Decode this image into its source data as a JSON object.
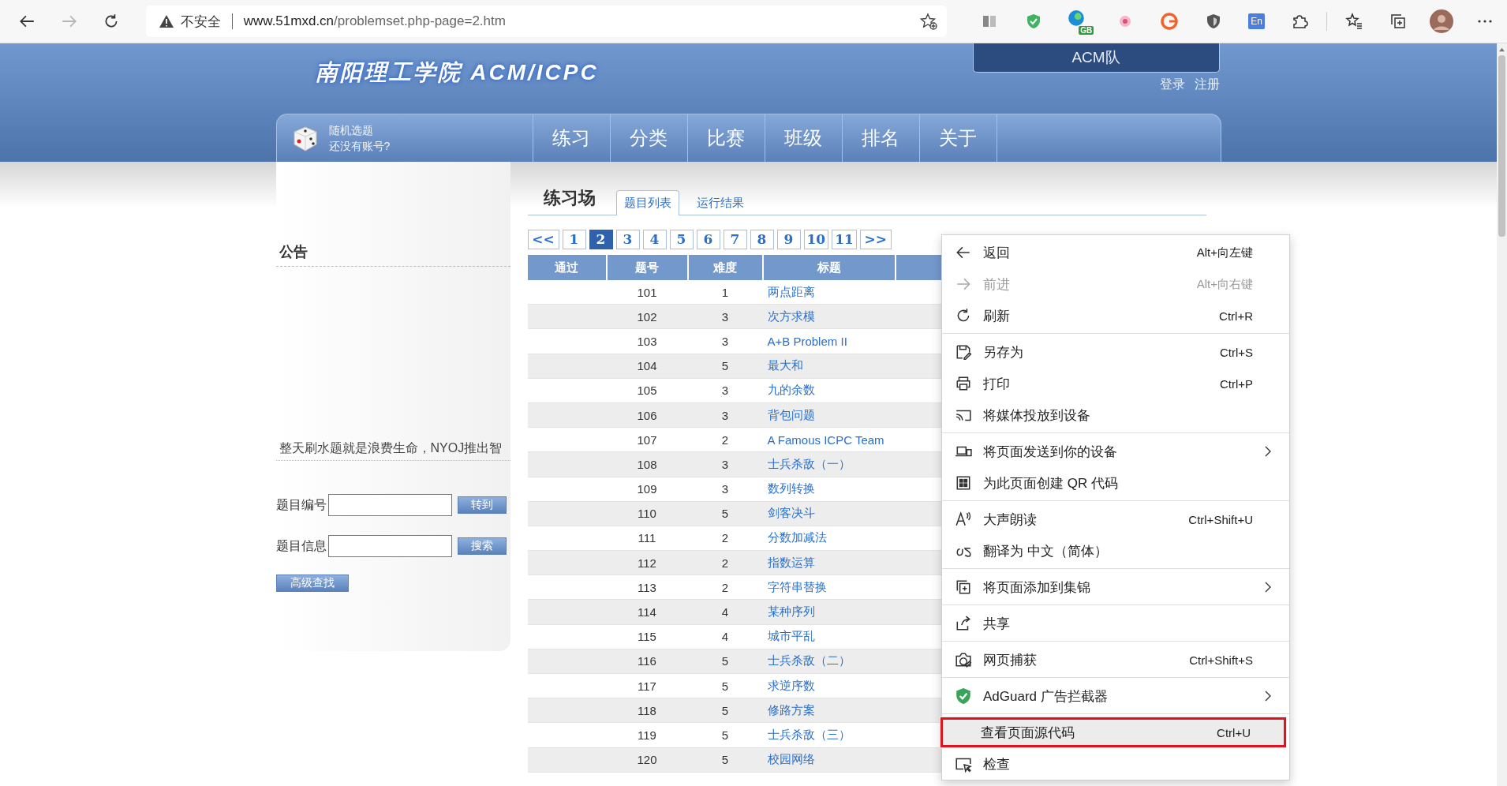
{
  "browser": {
    "back_disabled": false,
    "forward_disabled": true,
    "address": {
      "warning": "不安全",
      "host": "www.51mxd.cn",
      "path": "/problemset.php-page=2.htm"
    },
    "extension_labels": [
      "GB",
      "En"
    ]
  },
  "site": {
    "logo": "南阳理工学院 ACM/ICPC",
    "team": "ACM队",
    "account_links": [
      "登录",
      "注册"
    ],
    "nav_side": [
      "随机选题",
      "还没有账号?"
    ],
    "nav": [
      "练习",
      "分类",
      "比赛",
      "班级",
      "排名",
      "关于"
    ]
  },
  "sidebar": {
    "notice_title": "公告",
    "notice_text": "整天刷水题就是浪费生命，NYOJ推出智",
    "fields": [
      {
        "label": "题目编号",
        "button": "转到"
      },
      {
        "label": "题目信息",
        "button": "搜索"
      }
    ],
    "advanced_button": "高级查找"
  },
  "main": {
    "title": "练习场",
    "tabs": [
      {
        "label": "题目列表",
        "selected": true
      },
      {
        "label": "运行结果",
        "selected": false
      }
    ],
    "pages": [
      {
        "label": "<<",
        "selected": false
      },
      {
        "label": "1",
        "selected": false
      },
      {
        "label": "2",
        "selected": true
      },
      {
        "label": "3",
        "selected": false
      },
      {
        "label": "4",
        "selected": false
      },
      {
        "label": "5",
        "selected": false
      },
      {
        "label": "6",
        "selected": false
      },
      {
        "label": "7",
        "selected": false
      },
      {
        "label": "8",
        "selected": false
      },
      {
        "label": "9",
        "selected": false
      },
      {
        "label": "10",
        "selected": false
      },
      {
        "label": "11",
        "selected": false
      },
      {
        "label": ">>",
        "selected": false
      }
    ],
    "table": {
      "columns": [
        "通过",
        "题号",
        "难度",
        "标题"
      ],
      "rows": [
        {
          "id": "101",
          "difficulty": "1",
          "title": "两点距离"
        },
        {
          "id": "102",
          "difficulty": "3",
          "title": "次方求模"
        },
        {
          "id": "103",
          "difficulty": "3",
          "title": "A+B Problem II"
        },
        {
          "id": "104",
          "difficulty": "5",
          "title": "最大和"
        },
        {
          "id": "105",
          "difficulty": "3",
          "title": "九的余数"
        },
        {
          "id": "106",
          "difficulty": "3",
          "title": "背包问题"
        },
        {
          "id": "107",
          "difficulty": "2",
          "title": "A Famous ICPC Team"
        },
        {
          "id": "108",
          "difficulty": "3",
          "title": "士兵杀敌（一）"
        },
        {
          "id": "109",
          "difficulty": "3",
          "title": "数列转换"
        },
        {
          "id": "110",
          "difficulty": "5",
          "title": "剑客决斗"
        },
        {
          "id": "111",
          "difficulty": "2",
          "title": "分数加减法"
        },
        {
          "id": "112",
          "difficulty": "2",
          "title": "指数运算"
        },
        {
          "id": "113",
          "difficulty": "2",
          "title": "字符串替换"
        },
        {
          "id": "114",
          "difficulty": "4",
          "title": "某种序列"
        },
        {
          "id": "115",
          "difficulty": "4",
          "title": "城市平乱"
        },
        {
          "id": "116",
          "difficulty": "5",
          "title": "士兵杀敌（二）"
        },
        {
          "id": "117",
          "difficulty": "5",
          "title": "求逆序数"
        },
        {
          "id": "118",
          "difficulty": "5",
          "title": "修路方案"
        },
        {
          "id": "119",
          "difficulty": "5",
          "title": "士兵杀敌（三）"
        },
        {
          "id": "120",
          "difficulty": "5",
          "title": "校园网络"
        }
      ]
    }
  },
  "context_menu": {
    "groups": [
      [
        {
          "label": "返回",
          "shortcut": "Alt+向左键",
          "disabled": false,
          "submenu": false,
          "highlighted": false
        },
        {
          "label": "前进",
          "shortcut": "Alt+向右键",
          "disabled": true,
          "submenu": false,
          "highlighted": false
        },
        {
          "label": "刷新",
          "shortcut": "Ctrl+R",
          "disabled": false,
          "submenu": false,
          "highlighted": false
        }
      ],
      [
        {
          "label": "另存为",
          "shortcut": "Ctrl+S",
          "disabled": false,
          "submenu": false,
          "highlighted": false
        },
        {
          "label": "打印",
          "shortcut": "Ctrl+P",
          "disabled": false,
          "submenu": false,
          "highlighted": false
        },
        {
          "label": "将媒体投放到设备",
          "disabled": false,
          "submenu": false,
          "highlighted": false
        }
      ],
      [
        {
          "label": "将页面发送到你的设备",
          "disabled": false,
          "submenu": true,
          "highlighted": false
        },
        {
          "label": "为此页面创建 QR 代码",
          "disabled": false,
          "submenu": false,
          "highlighted": false
        }
      ],
      [
        {
          "label": "大声朗读",
          "shortcut": "Ctrl+Shift+U",
          "disabled": false,
          "submenu": false,
          "highlighted": false
        },
        {
          "label": "翻译为 中文（简体）",
          "disabled": false,
          "submenu": false,
          "highlighted": false
        }
      ],
      [
        {
          "label": "将页面添加到集锦",
          "disabled": false,
          "submenu": true,
          "highlighted": false
        }
      ],
      [
        {
          "label": "共享",
          "disabled": false,
          "submenu": false,
          "highlighted": false
        }
      ],
      [
        {
          "label": "网页捕获",
          "shortcut": "Ctrl+Shift+S",
          "disabled": false,
          "submenu": false,
          "highlighted": false
        }
      ],
      [
        {
          "label": "AdGuard 广告拦截器",
          "disabled": false,
          "submenu": true,
          "highlighted": false
        }
      ],
      [
        {
          "label": "查看页面源代码",
          "shortcut": "Ctrl+U",
          "disabled": false,
          "submenu": false,
          "highlighted": true
        },
        {
          "label": "检查",
          "disabled": false,
          "submenu": false,
          "highlighted": false
        }
      ]
    ]
  }
}
